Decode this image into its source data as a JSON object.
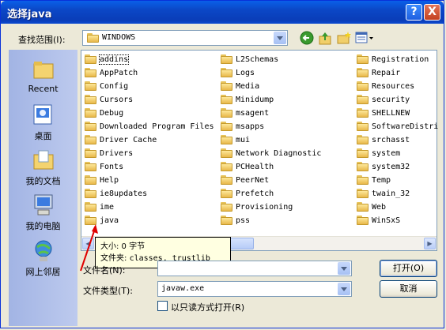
{
  "window": {
    "title": "选择java",
    "help": "?",
    "close": "X"
  },
  "lookin": {
    "label": "查找范围(I):",
    "value": "WINDOWS"
  },
  "places": [
    "Recent",
    "桌面",
    "我的文档",
    "我的电脑",
    "网上邻居"
  ],
  "columns": [
    [
      "addins",
      "AppPatch",
      "Config",
      "Cursors",
      "Debug",
      "Downloaded Program Files",
      "Driver Cache",
      "Drivers",
      "Fonts",
      "Help",
      "ie8updates",
      "ime",
      "java"
    ],
    [
      "L2Schemas",
      "Logs",
      "Media",
      "Minidump",
      "msagent",
      "msapps",
      "mui",
      "Network Diagnostic",
      "PCHealth",
      "PeerNet",
      "Prefetch",
      "Provisioning",
      "pss"
    ],
    [
      "Registration",
      "Repair",
      "Resources",
      "security",
      "SHELLNEW",
      "SoftwareDistri",
      "srchasst",
      "system",
      "system32",
      "Temp",
      "twain_32",
      "Web",
      "WinSxS"
    ]
  ],
  "tooltip": {
    "line1": "大小: 0 字节",
    "line2_label": "文件夹:",
    "line2_value": "classes, trustlib"
  },
  "filename": {
    "label": "文件名(N):",
    "value": ""
  },
  "filetype": {
    "label": "文件类型(T):",
    "value": "javaw.exe"
  },
  "readonly_label": "以只读方式打开(R)",
  "buttons": {
    "open": "打开(O)",
    "cancel": "取消"
  }
}
